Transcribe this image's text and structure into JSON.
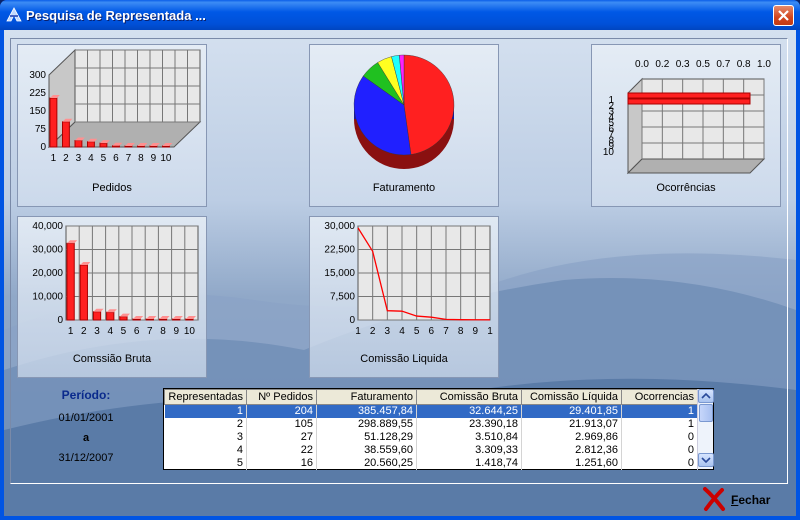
{
  "window": {
    "title": "Pesquisa de Representada ..."
  },
  "charts": {
    "pedidos": {
      "label": "Pedidos"
    },
    "faturamento": {
      "label": "Faturamento"
    },
    "ocorrencias": {
      "label": "Ocorrências"
    },
    "comissao_bruta": {
      "label": "Comssião Bruta"
    },
    "comissao_liquida": {
      "label": "Comissão Liquida"
    }
  },
  "chart_data": [
    {
      "type": "bar",
      "label": "Pedidos",
      "categories": [
        "1",
        "2",
        "3",
        "4",
        "5",
        "6",
        "7",
        "8",
        "9",
        "10"
      ],
      "values": [
        204,
        105,
        27,
        22,
        16,
        5,
        4,
        3,
        2,
        1
      ],
      "yticks": [
        "300",
        "225",
        "150",
        "75",
        "0"
      ],
      "ylim": [
        0,
        300
      ]
    },
    {
      "type": "pie",
      "label": "Faturamento",
      "values": [
        385457.84,
        298889.55,
        51128.29,
        38559.6,
        20560.25,
        12000
      ],
      "colors": [
        "#ff2020",
        "#2020ff",
        "#20c020",
        "#ffff20",
        "#20ffff",
        "#ff20ff"
      ]
    },
    {
      "type": "bar",
      "label": "Ocorrências",
      "categories": [
        "1",
        "2",
        "3",
        "4",
        "5",
        "6",
        "7",
        "8",
        "9",
        "10"
      ],
      "values": [
        1,
        1,
        0,
        0,
        0,
        0,
        0,
        0,
        0,
        0
      ],
      "xticks": [
        "0.0",
        "0.2",
        "0.3",
        "0.5",
        "0.7",
        "0.8",
        "1.0"
      ],
      "xlim": [
        0,
        1
      ]
    },
    {
      "type": "bar",
      "label": "Comssião Bruta",
      "categories": [
        "1",
        "2",
        "3",
        "4",
        "5",
        "6",
        "7",
        "8",
        "9",
        "10"
      ],
      "values": [
        32644.25,
        23390.18,
        3510.84,
        3309.33,
        1418.74,
        100,
        80,
        60,
        50,
        400
      ],
      "yticks": [
        "40,000",
        "30,000",
        "20,000",
        "10,000",
        "0"
      ],
      "ylim": [
        0,
        40000
      ]
    },
    {
      "type": "line",
      "label": "Comissão Liquida",
      "categories": [
        "1",
        "2",
        "3",
        "4",
        "5",
        "6",
        "7",
        "8",
        "9",
        "1"
      ],
      "values": [
        29401.85,
        21913.07,
        2969.86,
        2812.36,
        1251.6,
        900,
        200,
        100,
        80,
        60
      ],
      "yticks": [
        "30,000",
        "22,500",
        "15,000",
        "7,500",
        "0"
      ],
      "ylim": [
        0,
        30000
      ]
    }
  ],
  "period": {
    "title": "Período:",
    "from": "01/01/2001",
    "sep": "a",
    "to": "31/12/2007"
  },
  "table": {
    "headers": [
      "Representadas",
      "Nº Pedidos",
      "Faturamento",
      "Comissão Bruta",
      "Comissão Líquida",
      "Ocorrencias"
    ],
    "rows": [
      [
        "1",
        "204",
        "385.457,84",
        "32.644,25",
        "29.401,85",
        "1"
      ],
      [
        "2",
        "105",
        "298.889,55",
        "23.390,18",
        "21.913,07",
        "1"
      ],
      [
        "3",
        "27",
        "51.128,29",
        "3.510,84",
        "2.969,86",
        "0"
      ],
      [
        "4",
        "22",
        "38.559,60",
        "3.309,33",
        "2.812,36",
        "0"
      ],
      [
        "5",
        "16",
        "20.560,25",
        "1.418,74",
        "1.251,60",
        "0"
      ]
    ],
    "selected_row": 0
  },
  "buttons": {
    "fechar": "Fechar"
  },
  "colors": {
    "title_bar": "#0054e3",
    "selection": "#316ac5",
    "bar": "#ff2020",
    "close": "#d2451e"
  }
}
